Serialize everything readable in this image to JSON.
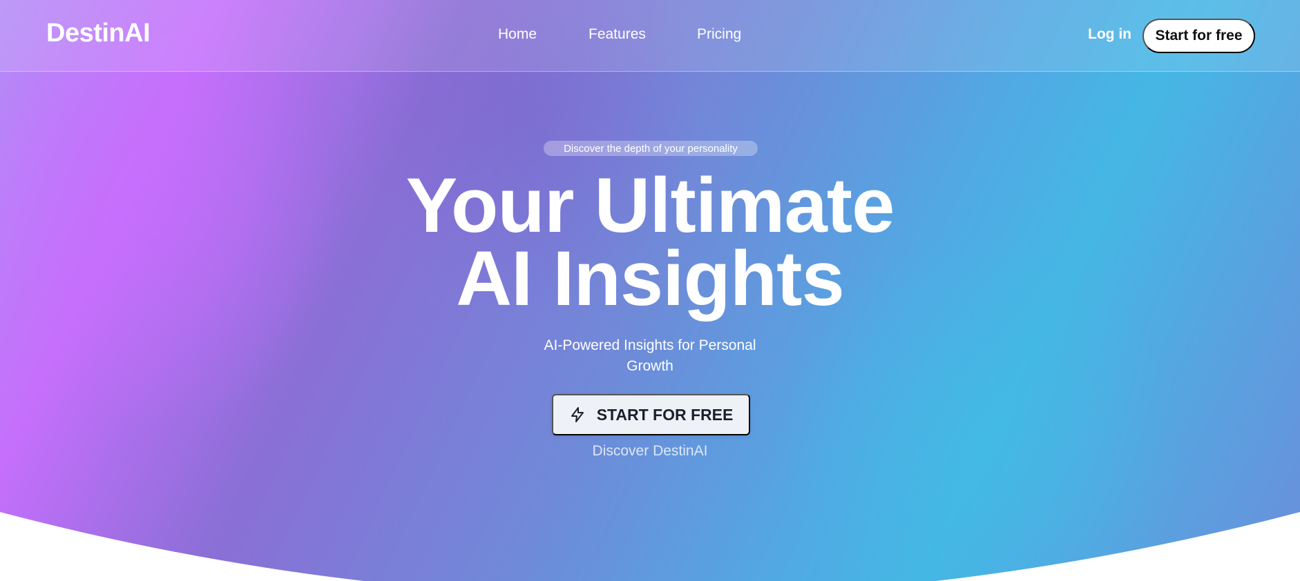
{
  "brand": {
    "logo": "DestinAI"
  },
  "nav": {
    "links": [
      "Home",
      "Features",
      "Pricing"
    ],
    "login_label": "Log in",
    "cta_label": "Start for free"
  },
  "hero": {
    "badge": "Discover the depth of your personality",
    "headline_line1": "Your Ultimate",
    "headline_line2": "AI Insights",
    "subtitle_line1": "AI-Powered Insights for Personal",
    "subtitle_line2": "Growth",
    "cta_label": "START FOR FREE",
    "cta_icon": "bolt-icon",
    "secondary_link": "Discover DestinAI"
  },
  "colors": {
    "purple": "#c56ffc",
    "blue": "#45b7e5",
    "button_bg": "#eef2f6"
  }
}
